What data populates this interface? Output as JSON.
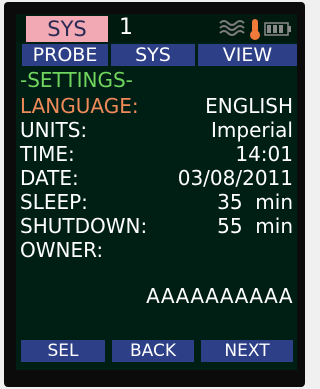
{
  "status": {
    "mode": "SYS",
    "channel": "1",
    "icons": [
      "wave-icon",
      "thermometer-icon",
      "battery-icon"
    ]
  },
  "tabs": [
    {
      "label": "PROBE"
    },
    {
      "label": "SYS"
    },
    {
      "label": "VIEW"
    }
  ],
  "settings": {
    "title": "-SETTINGS-",
    "rows": [
      {
        "label": "LANGUAGE:",
        "value": "ENGLISH"
      },
      {
        "label": "UNITS:",
        "value": "Imperial"
      },
      {
        "label": "TIME:",
        "value": "14:01"
      },
      {
        "label": "DATE:",
        "value": "03/08/2011"
      },
      {
        "label": "SLEEP:",
        "value": "35  min"
      },
      {
        "label": "SHUTDOWN:",
        "value": "55  min"
      },
      {
        "label": "OWNER:",
        "value": "AAAAAAAAAA"
      }
    ]
  },
  "softkeys": [
    "SEL",
    "BACK",
    "NEXT"
  ],
  "colors": {
    "screen_bg": "#001f14",
    "tab_bg": "#2d3f86",
    "title": "#6fd55f",
    "selected_label": "#f08a5a",
    "mode_badge": "#f2a9b3"
  }
}
